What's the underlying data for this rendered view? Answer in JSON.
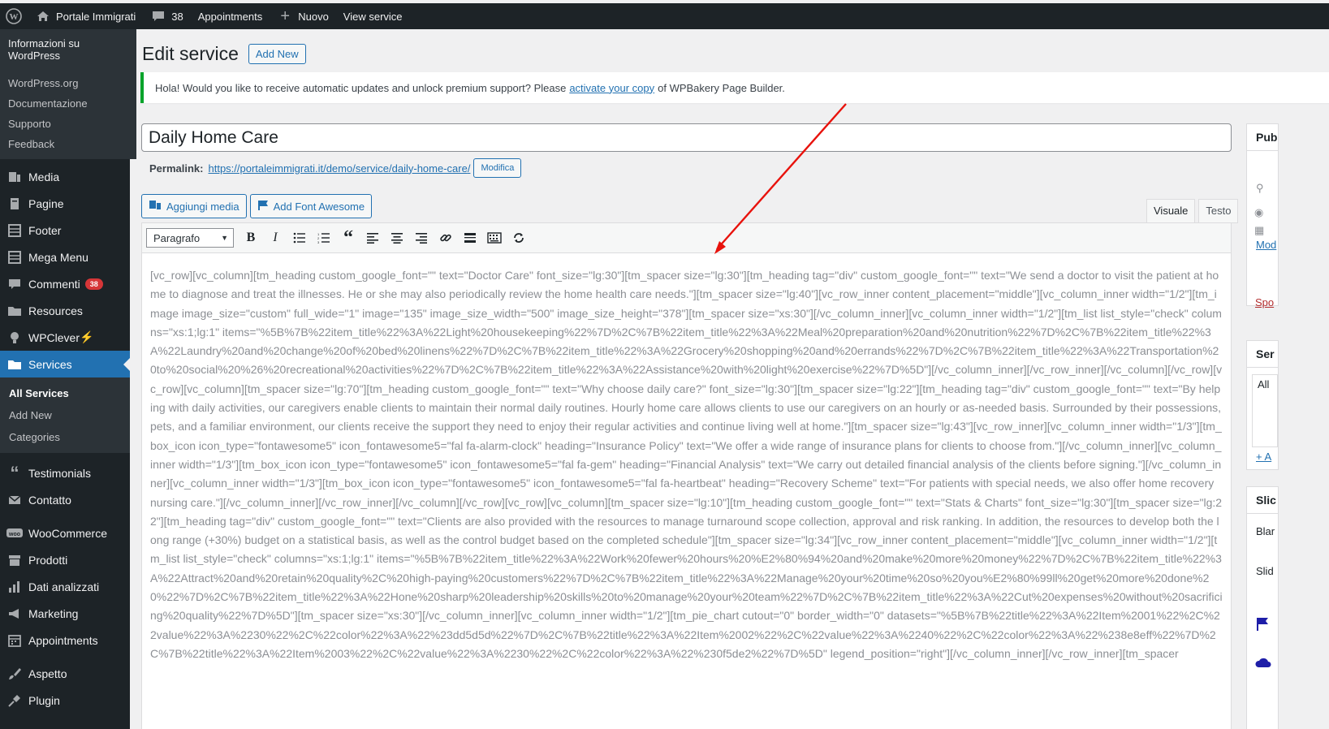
{
  "adminbar": {
    "site_name": "Portale Immigrati",
    "comments_count": "38",
    "appointments": "Appointments",
    "new_label": "Nuovo",
    "view_label": "View service"
  },
  "wp_menu": {
    "heading": "Informazioni su WordPress",
    "items": [
      "WordPress.org",
      "Documentazione",
      "Supporto",
      "Feedback"
    ]
  },
  "sidebar": {
    "items": [
      {
        "label": "Media",
        "icon": "media-icon"
      },
      {
        "label": "Pagine",
        "icon": "pages-icon"
      },
      {
        "label": "Footer",
        "icon": "footer-icon"
      },
      {
        "label": "Mega Menu",
        "icon": "mega-menu-icon"
      },
      {
        "label": "Commenti",
        "icon": "comments-icon",
        "badge": "38"
      },
      {
        "label": "Resources",
        "icon": "folder-icon"
      },
      {
        "label": "WPClever",
        "icon": "bulb-icon",
        "suffix": "⚡"
      },
      {
        "label": "Services",
        "icon": "folder-icon"
      },
      {
        "label": "Testimonials",
        "icon": "quote-icon"
      },
      {
        "label": "Contatto",
        "icon": "mail-icon"
      },
      {
        "label": "WooCommerce",
        "icon": "woo-icon"
      },
      {
        "label": "Prodotti",
        "icon": "archive-icon"
      },
      {
        "label": "Dati analizzati",
        "icon": "chart-icon"
      },
      {
        "label": "Marketing",
        "icon": "megaphone-icon"
      },
      {
        "label": "Appointments",
        "icon": "calendar-icon"
      },
      {
        "label": "Aspetto",
        "icon": "brush-icon"
      },
      {
        "label": "Plugin",
        "icon": "plugin-icon"
      }
    ],
    "services_sub": [
      "All Services",
      "Add New",
      "Categories"
    ]
  },
  "page": {
    "title": "Edit service",
    "add_new": "Add New"
  },
  "notice": {
    "before": "Hola! Would you like to receive automatic updates and unlock premium support? Please",
    "link": "activate your copy",
    "after": "of WPBakery Page Builder."
  },
  "post": {
    "title": "Daily Home Care",
    "permalink_label": "Permalink:",
    "permalink_base": "https://portaleimmigrati.it/demo/service/",
    "permalink_slug": "daily-home-care",
    "permalink_end": "/",
    "modify": "Modifica"
  },
  "media": {
    "add_media": "Aggiungi media",
    "add_font": "Add Font Awesome"
  },
  "editor_tabs": {
    "visual": "Visuale",
    "text": "Testo"
  },
  "toolbar": {
    "format": "Paragrafo"
  },
  "content": "[vc_row][vc_column][tm_heading custom_google_font=\"\" text=\"Doctor Care\" font_size=\"lg:30\"][tm_spacer size=\"lg:30\"][tm_heading tag=\"div\" custom_google_font=\"\" text=\"We send a doctor to visit the patient at home to diagnose and treat the illnesses. He or she may also periodically review the home health care needs.\"][tm_spacer size=\"lg:40\"][vc_row_inner content_placement=\"middle\"][vc_column_inner width=\"1/2\"][tm_image image_size=\"custom\" full_wide=\"1\" image=\"135\" image_size_width=\"500\" image_size_height=\"378\"][tm_spacer size=\"xs:30\"][/vc_column_inner][vc_column_inner width=\"1/2\"][tm_list list_style=\"check\" columns=\"xs:1;lg:1\" items=\"%5B%7B%22item_title%22%3A%22Light%20housekeeping%22%7D%2C%7B%22item_title%22%3A%22Meal%20preparation%20and%20nutrition%22%7D%2C%7B%22item_title%22%3A%22Laundry%20and%20change%20of%20bed%20linens%22%7D%2C%7B%22item_title%22%3A%22Grocery%20shopping%20and%20errands%22%7D%2C%7B%22item_title%22%3A%22Transportation%20to%20social%20%26%20recreational%20activities%22%7D%2C%7B%22item_title%22%3A%22Assistance%20with%20light%20exercise%22%7D%5D\"][/vc_column_inner][/vc_row_inner][/vc_column][/vc_row][vc_row][vc_column][tm_spacer size=\"lg:70\"][tm_heading custom_google_font=\"\" text=\"Why choose daily care?\" font_size=\"lg:30\"][tm_spacer size=\"lg:22\"][tm_heading tag=\"div\" custom_google_font=\"\" text=\"By helping with daily activities, our caregivers enable clients to maintain their normal daily routines. Hourly home care allows clients to use our caregivers on an hourly or as-needed basis. Surrounded by their possessions, pets, and a familiar environment, our clients receive the support they need to enjoy their regular activities and continue living well at home.\"][tm_spacer size=\"lg:43\"][vc_row_inner][vc_column_inner width=\"1/3\"][tm_box_icon icon_type=\"fontawesome5\" icon_fontawesome5=\"fal fa-alarm-clock\" heading=\"Insurance Policy\" text=\"We offer a wide range of insurance plans for clients to choose from.\"][/vc_column_inner][vc_column_inner width=\"1/3\"][tm_box_icon icon_type=\"fontawesome5\" icon_fontawesome5=\"fal fa-gem\" heading=\"Financial Analysis\" text=\"We carry out detailed financial analysis of the clients before signing.\"][/vc_column_inner][vc_column_inner width=\"1/3\"][tm_box_icon icon_type=\"fontawesome5\" icon_fontawesome5=\"fal fa-heartbeat\" heading=\"Recovery Scheme\" text=\"For patients with special needs, we also offer home recovery nursing care.\"][/vc_column_inner][/vc_row_inner][/vc_column][/vc_row][vc_row][vc_column][tm_spacer size=\"lg:10\"][tm_heading custom_google_font=\"\" text=\"Stats & Charts\" font_size=\"lg:30\"][tm_spacer size=\"lg:22\"][tm_heading tag=\"div\" custom_google_font=\"\" text=\"Clients are also provided with the resources to manage turnaround scope collection, approval and risk ranking. In addition, the resources to develop both the long range (+30%) budget on a statistical basis, as well as the control budget based on the completed schedule\"][tm_spacer size=\"lg:34\"][vc_row_inner content_placement=\"middle\"][vc_column_inner width=\"1/2\"][tm_list list_style=\"check\" columns=\"xs:1;lg:1\" items=\"%5B%7B%22item_title%22%3A%22Work%20fewer%20hours%20%E2%80%94%20and%20make%20more%20money%22%7D%2C%7B%22item_title%22%3A%22Attract%20and%20retain%20quality%2C%20high-paying%20customers%22%7D%2C%7B%22item_title%22%3A%22Manage%20your%20time%20so%20you%E2%80%99ll%20get%20more%20done%20%22%7D%2C%7B%22item_title%22%3A%22Hone%20sharp%20leadership%20skills%20to%20manage%20your%20team%22%7D%2C%7B%22item_title%22%3A%22Cut%20expenses%20without%20sacrificing%20quality%22%7D%5D\"][tm_spacer size=\"xs:30\"][/vc_column_inner][vc_column_inner width=\"1/2\"][tm_pie_chart cutout=\"0\" border_width=\"0\" datasets=\"%5B%7B%22title%22%3A%22Item%2001%22%2C%22value%22%3A%2230%22%2C%22color%22%3A%22%23dd5d5d%22%7D%2C%7B%22title%22%3A%22Item%2002%22%2C%22value%22%3A%2240%22%2C%22color%22%3A%22%238e8eff%22%7D%2C%7B%22title%22%3A%22Item%2003%22%2C%22value%22%3A%2230%22%2C%22color%22%3A%22%230f5de2%22%7D%5D\" legend_position=\"right\"][/vc_column_inner][/vc_row_inner][tm_spacer",
  "right": {
    "publish": "Pub",
    "modify_link": "Mod",
    "sponsor": "Spo",
    "services": "Ser",
    "all": "All",
    "add": "+ A",
    "slider": "Slic",
    "blank": "Blar",
    "slide": "Slid"
  },
  "colors": {
    "accent": "#2271b1",
    "admin_bg": "#1d2327",
    "notice_border": "#00a32a",
    "arrow": "#e8120c",
    "badge": "#d63638"
  }
}
